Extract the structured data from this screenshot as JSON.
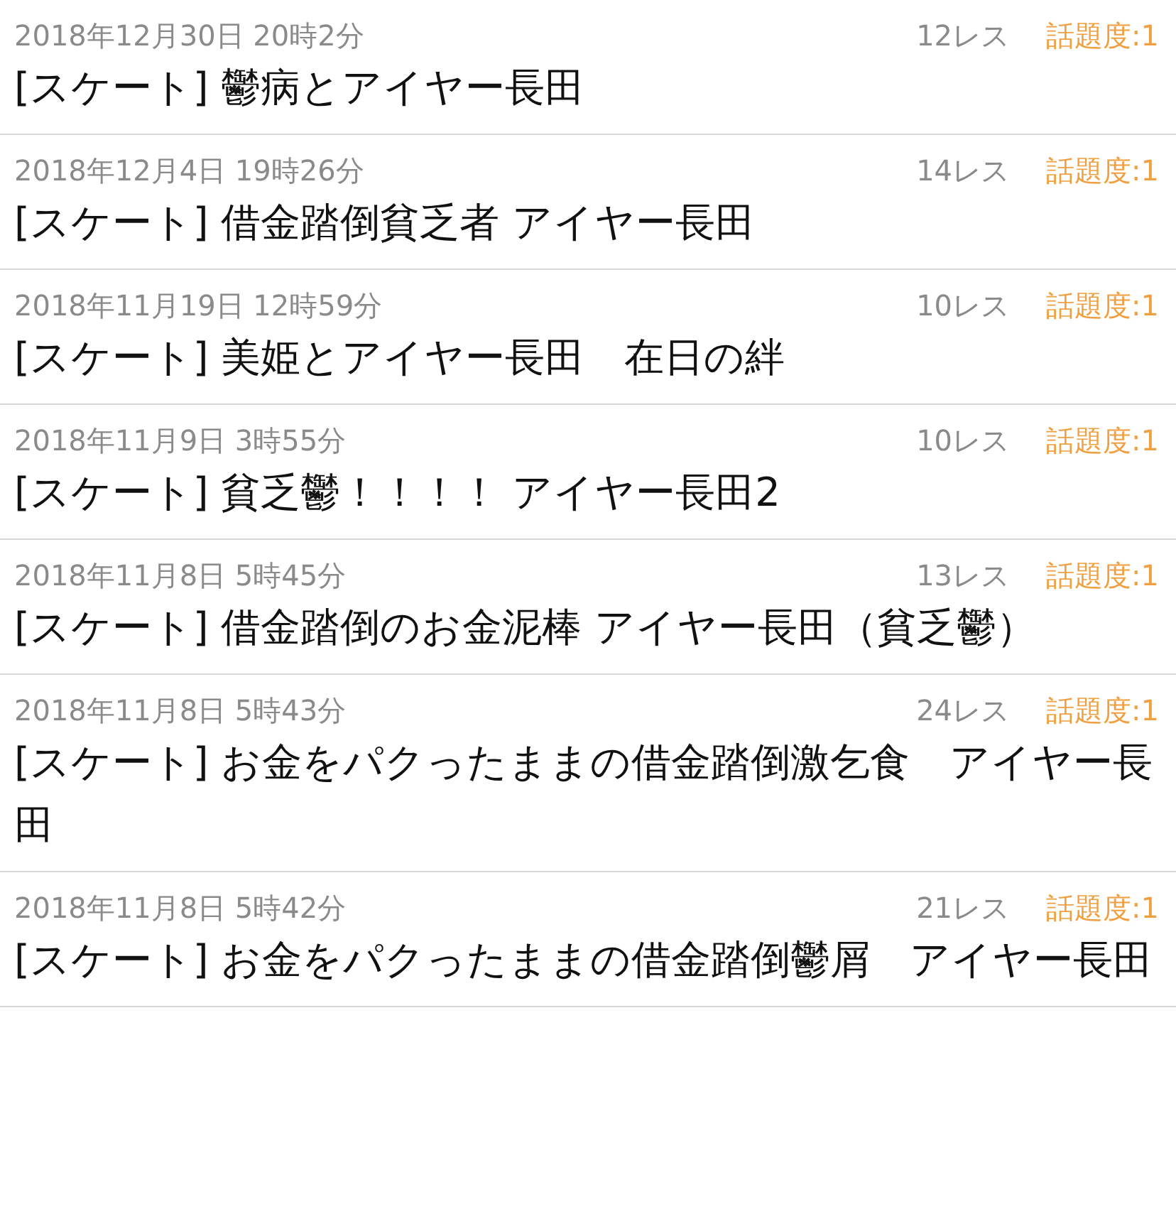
{
  "threads": [
    {
      "date": "2018年12月30日 20時2分",
      "replies": "12レス",
      "popularity": "話題度:1",
      "title": "[スケート] 鬱病とアイヤー長田"
    },
    {
      "date": "2018年12月4日 19時26分",
      "replies": "14レス",
      "popularity": "話題度:1",
      "title": "[スケート] 借金踏倒貧乏者 アイヤー長田"
    },
    {
      "date": "2018年11月19日 12時59分",
      "replies": "10レス",
      "popularity": "話題度:1",
      "title": "[スケート] 美姫とアイヤー長田　在日の絆"
    },
    {
      "date": "2018年11月9日 3時55分",
      "replies": "10レス",
      "popularity": "話題度:1",
      "title": "[スケート] 貧乏鬱！！！！ アイヤー長田2"
    },
    {
      "date": "2018年11月8日 5時45分",
      "replies": "13レス",
      "popularity": "話題度:1",
      "title": "[スケート] 借金踏倒のお金泥棒 アイヤー長田（貧乏鬱）"
    },
    {
      "date": "2018年11月8日 5時43分",
      "replies": "24レス",
      "popularity": "話題度:1",
      "title": "[スケート] お金をパクったままの借金踏倒激乞食　アイヤー長田"
    },
    {
      "date": "2018年11月8日 5時42分",
      "replies": "21レス",
      "popularity": "話題度:1",
      "title": "[スケート] お金をパクったままの借金踏倒鬱屑　アイヤー長田"
    }
  ]
}
